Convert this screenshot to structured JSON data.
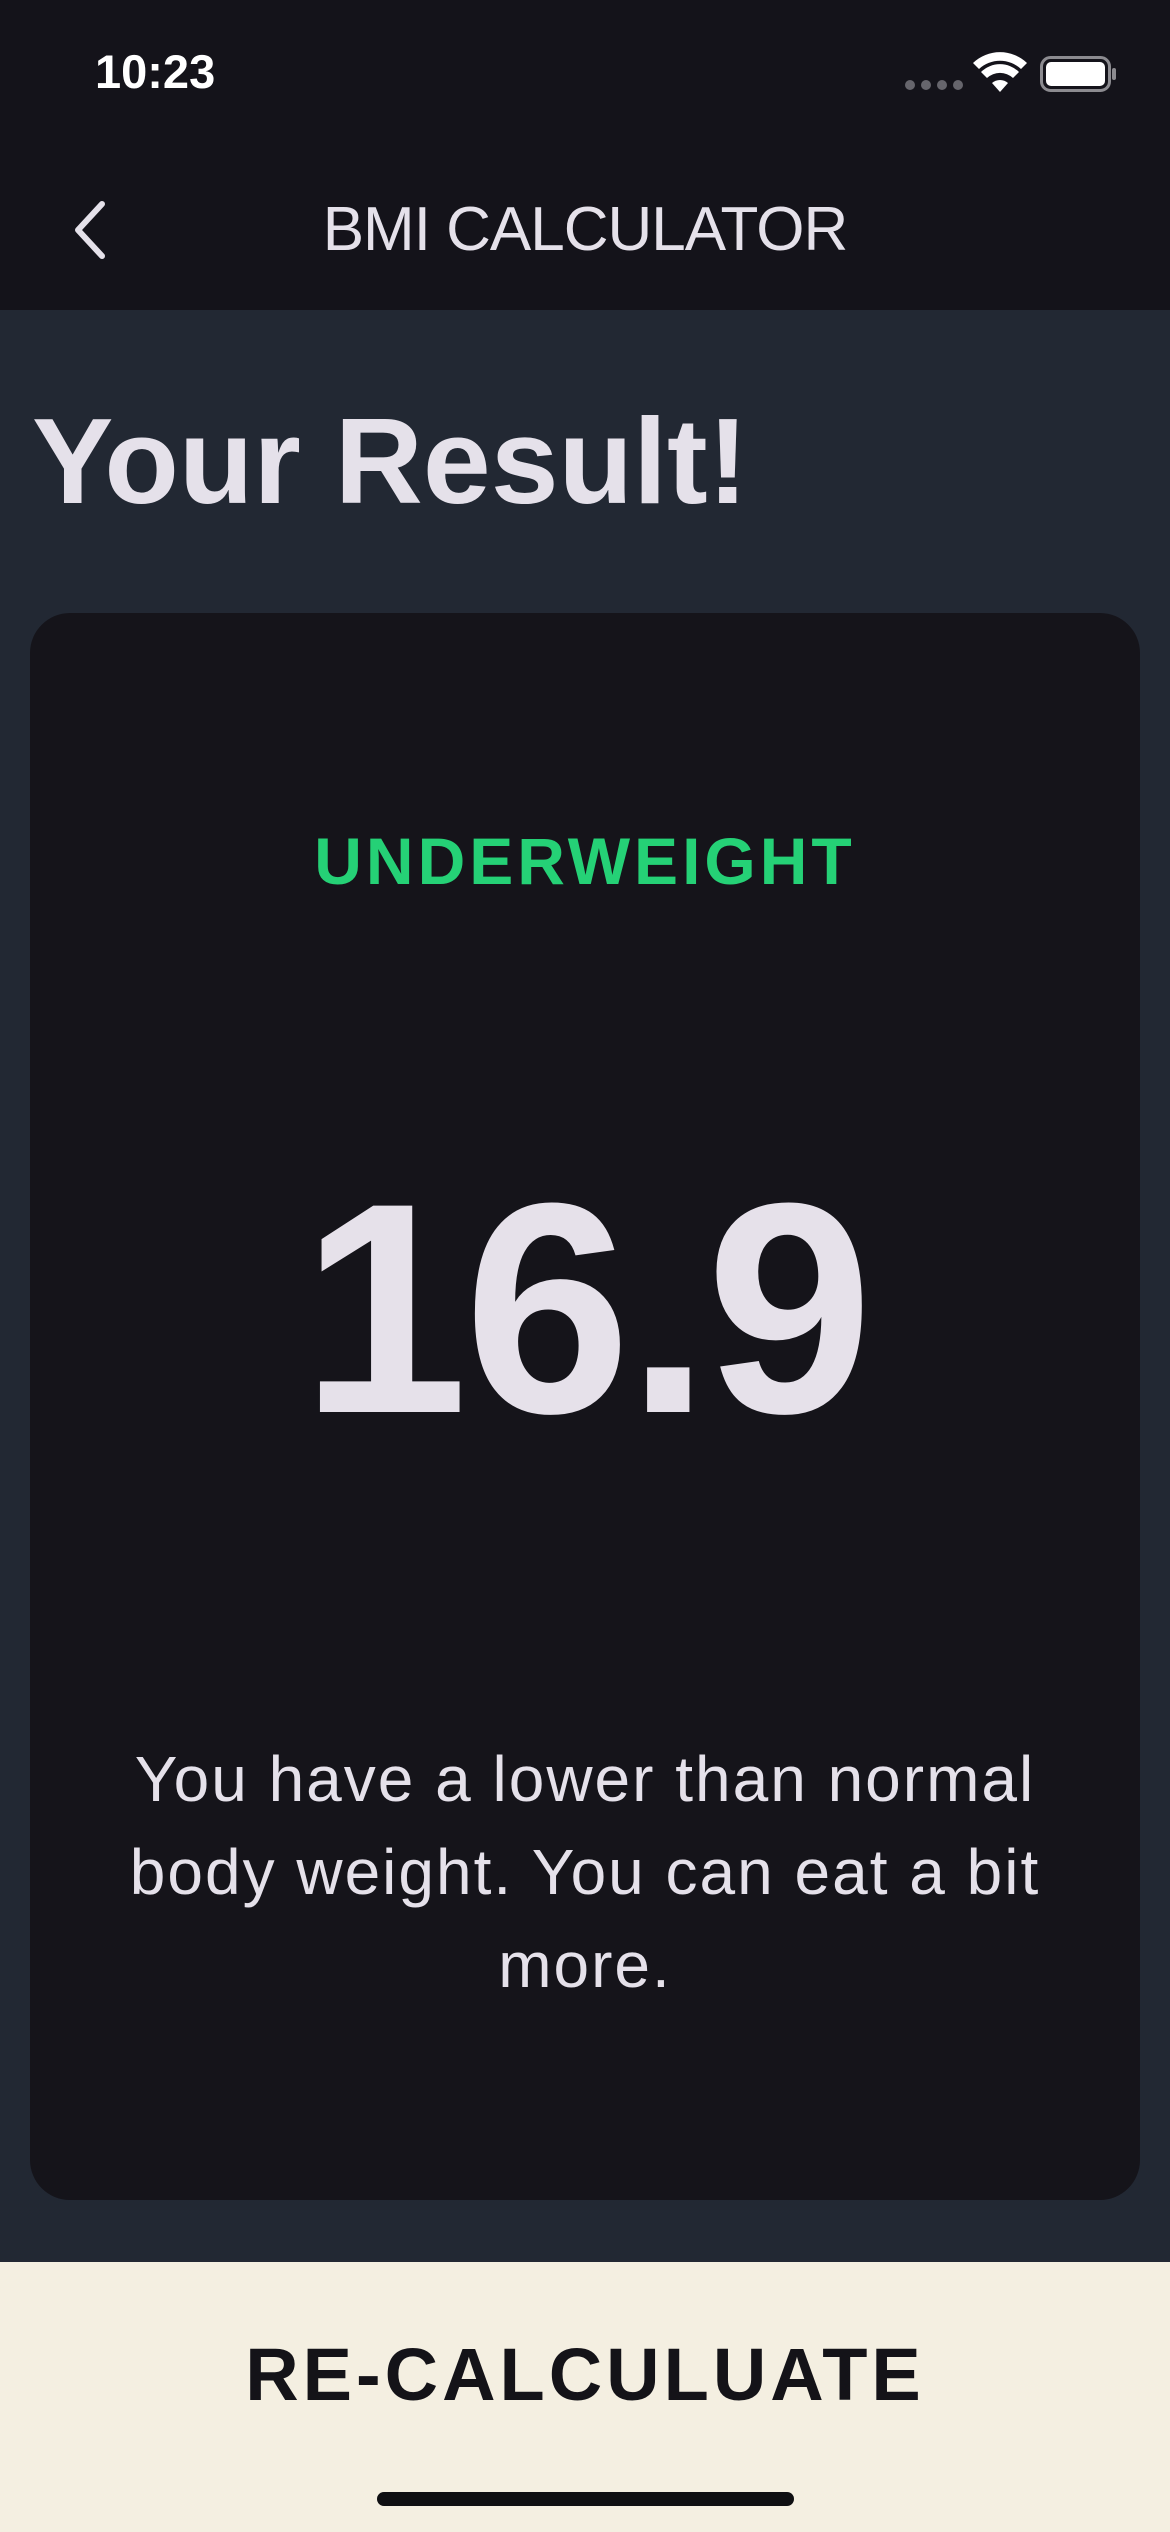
{
  "status_bar": {
    "time": "10:23"
  },
  "nav": {
    "title": "BMI CALCULATOR",
    "back_icon": "chevron-left-icon"
  },
  "page": {
    "title": "Your Result!"
  },
  "result": {
    "status": "UNDERWEIGHT",
    "value": "16.9",
    "message": "You have a lower than normal body weight. You can eat a bit more."
  },
  "action": {
    "recalculate_label": "RE-CALCULUATE"
  },
  "colors": {
    "background": "#222833",
    "card": "#15141a",
    "bar": "#14131a",
    "status_accent": "#25d176",
    "button": "#f4efe1",
    "text": "#e5e1ea"
  }
}
